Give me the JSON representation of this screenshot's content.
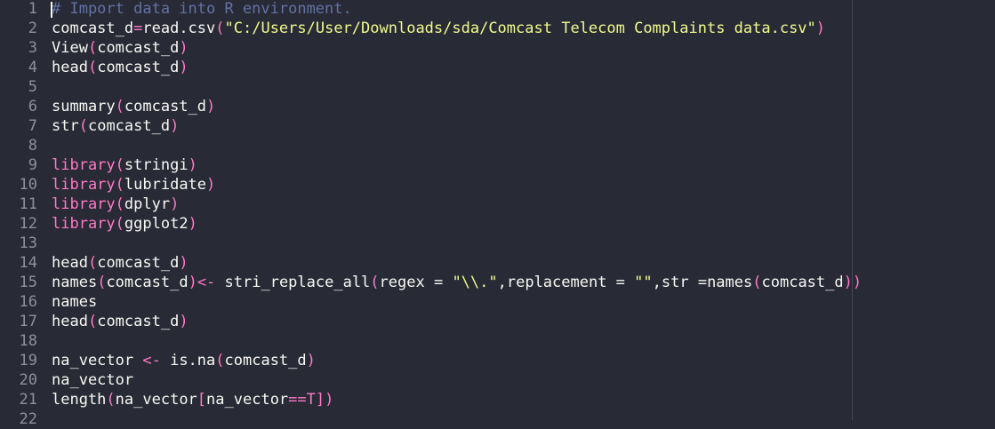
{
  "editor": {
    "lines": [
      {
        "n": "1",
        "code": [
          {
            "t": "# Import data into R environment.",
            "c": "c-comment"
          }
        ]
      },
      {
        "n": "2",
        "code": [
          {
            "t": "comcast_d",
            "c": "c-fn"
          },
          {
            "t": "=",
            "c": "c-op"
          },
          {
            "t": "read.csv",
            "c": "c-fn"
          },
          {
            "t": "(",
            "c": "c-paren"
          },
          {
            "t": "\"C:/Users/User/Downloads/sda/Comcast Telecom Complaints data.csv\"",
            "c": "c-string"
          },
          {
            "t": ")",
            "c": "c-paren"
          }
        ]
      },
      {
        "n": "3",
        "code": [
          {
            "t": "View",
            "c": "c-fn"
          },
          {
            "t": "(",
            "c": "c-paren"
          },
          {
            "t": "comcast_d",
            "c": "c-fn"
          },
          {
            "t": ")",
            "c": "c-paren"
          }
        ]
      },
      {
        "n": "4",
        "code": [
          {
            "t": "head",
            "c": "c-fn"
          },
          {
            "t": "(",
            "c": "c-paren"
          },
          {
            "t": "comcast_d",
            "c": "c-fn"
          },
          {
            "t": ")",
            "c": "c-paren"
          }
        ]
      },
      {
        "n": "5",
        "code": []
      },
      {
        "n": "6",
        "code": [
          {
            "t": "summary",
            "c": "c-fn"
          },
          {
            "t": "(",
            "c": "c-paren"
          },
          {
            "t": "comcast_d",
            "c": "c-fn"
          },
          {
            "t": ")",
            "c": "c-paren"
          }
        ]
      },
      {
        "n": "7",
        "code": [
          {
            "t": "str",
            "c": "c-fn"
          },
          {
            "t": "(",
            "c": "c-paren"
          },
          {
            "t": "comcast_d",
            "c": "c-fn"
          },
          {
            "t": ")",
            "c": "c-paren"
          }
        ]
      },
      {
        "n": "8",
        "code": []
      },
      {
        "n": "9",
        "code": [
          {
            "t": "library",
            "c": "c-op"
          },
          {
            "t": "(",
            "c": "c-paren"
          },
          {
            "t": "stringi",
            "c": "c-fn"
          },
          {
            "t": ")",
            "c": "c-paren"
          }
        ]
      },
      {
        "n": "10",
        "code": [
          {
            "t": "library",
            "c": "c-op"
          },
          {
            "t": "(",
            "c": "c-paren"
          },
          {
            "t": "lubridate",
            "c": "c-fn"
          },
          {
            "t": ")",
            "c": "c-paren"
          }
        ]
      },
      {
        "n": "11",
        "code": [
          {
            "t": "library",
            "c": "c-op"
          },
          {
            "t": "(",
            "c": "c-paren"
          },
          {
            "t": "dplyr",
            "c": "c-fn"
          },
          {
            "t": ")",
            "c": "c-paren"
          }
        ]
      },
      {
        "n": "12",
        "code": [
          {
            "t": "library",
            "c": "c-op"
          },
          {
            "t": "(",
            "c": "c-paren"
          },
          {
            "t": "ggplot2",
            "c": "c-fn"
          },
          {
            "t": ")",
            "c": "c-paren"
          }
        ]
      },
      {
        "n": "13",
        "code": []
      },
      {
        "n": "14",
        "code": [
          {
            "t": "head",
            "c": "c-fn"
          },
          {
            "t": "(",
            "c": "c-paren"
          },
          {
            "t": "comcast_d",
            "c": "c-fn"
          },
          {
            "t": ")",
            "c": "c-paren"
          }
        ]
      },
      {
        "n": "15",
        "code": [
          {
            "t": "names",
            "c": "c-fn"
          },
          {
            "t": "(",
            "c": "c-paren"
          },
          {
            "t": "comcast_d",
            "c": "c-fn"
          },
          {
            "t": ")",
            "c": "c-paren"
          },
          {
            "t": "<-",
            "c": "c-op"
          },
          {
            "t": " stri_replace_all",
            "c": "c-fn"
          },
          {
            "t": "(",
            "c": "c-paren"
          },
          {
            "t": "regex = ",
            "c": "c-fn"
          },
          {
            "t": "\"\\\\.\"",
            "c": "c-string"
          },
          {
            "t": ",replacement = ",
            "c": "c-fn"
          },
          {
            "t": "\"\"",
            "c": "c-string"
          },
          {
            "t": ",str =",
            "c": "c-fn"
          },
          {
            "t": "names",
            "c": "c-fn"
          },
          {
            "t": "(",
            "c": "c-paren"
          },
          {
            "t": "comcast_d",
            "c": "c-fn"
          },
          {
            "t": "))",
            "c": "c-paren"
          }
        ]
      },
      {
        "n": "16",
        "code": [
          {
            "t": "names",
            "c": "c-fn"
          }
        ]
      },
      {
        "n": "17",
        "code": [
          {
            "t": "head",
            "c": "c-fn"
          },
          {
            "t": "(",
            "c": "c-paren"
          },
          {
            "t": "comcast_d",
            "c": "c-fn"
          },
          {
            "t": ")",
            "c": "c-paren"
          }
        ]
      },
      {
        "n": "18",
        "code": []
      },
      {
        "n": "19",
        "code": [
          {
            "t": "na_vector ",
            "c": "c-fn"
          },
          {
            "t": "<-",
            "c": "c-op"
          },
          {
            "t": " is.na",
            "c": "c-fn"
          },
          {
            "t": "(",
            "c": "c-paren"
          },
          {
            "t": "comcast_d",
            "c": "c-fn"
          },
          {
            "t": ")",
            "c": "c-paren"
          }
        ]
      },
      {
        "n": "20",
        "code": [
          {
            "t": "na_vector",
            "c": "c-fn"
          }
        ]
      },
      {
        "n": "21",
        "code": [
          {
            "t": "length",
            "c": "c-fn"
          },
          {
            "t": "(",
            "c": "c-paren"
          },
          {
            "t": "na_vector",
            "c": "c-fn"
          },
          {
            "t": "[",
            "c": "c-paren"
          },
          {
            "t": "na_vector",
            "c": "c-fn"
          },
          {
            "t": "==",
            "c": "c-op"
          },
          {
            "t": "T",
            "c": "c-op"
          },
          {
            "t": "])",
            "c": "c-paren"
          }
        ]
      },
      {
        "n": "22",
        "code": []
      }
    ]
  }
}
